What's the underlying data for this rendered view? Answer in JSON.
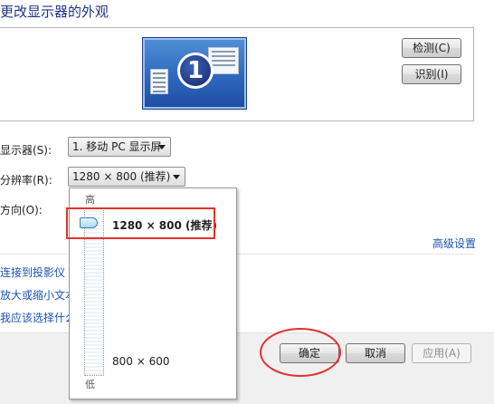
{
  "window": {
    "title": "更改显示器的外观"
  },
  "preview": {
    "monitor_number": "1"
  },
  "buttons": {
    "detect": "检测(C)",
    "identify": "识别(I)",
    "ok": "确定",
    "cancel": "取消",
    "apply": "应用(A)"
  },
  "fields": {
    "display_label": "显示器(S):",
    "display_value": "1. 移动 PC 显示屏",
    "resolution_label": "分辨率(R):",
    "resolution_value": "1280 × 800 (推荐)",
    "orientation_label": "方向(O):"
  },
  "links": {
    "advanced": "高级设置",
    "projector": "连接到投影仪 (",
    "text_size": "放大或缩小文本",
    "which": "我应该选择什么"
  },
  "resolution_dropdown": {
    "high_label": "高",
    "low_label": "低",
    "options": [
      "1280 × 800 (推荐)",
      "800 × 600"
    ],
    "selected_index": 0
  },
  "colors": {
    "highlight": "#e3322b",
    "link": "#1a53b5",
    "title": "#1e3287"
  }
}
